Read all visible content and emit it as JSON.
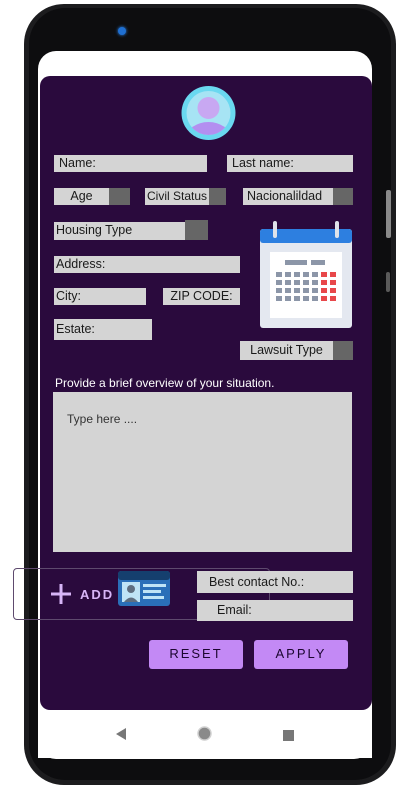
{
  "form": {
    "name_label": "Name:",
    "last_name_label": "Last name:",
    "age_label": "Age",
    "civil_status_label": "Civil Status",
    "nationality_label": "Nacionalildad",
    "housing_type_label": "Housing Type",
    "address_label": "Address:",
    "city_label": "City:",
    "zip_code_label": "ZIP CODE:",
    "estate_label": "Estate:",
    "lawsuit_type_label": "Lawsuit Type",
    "overview_prompt": "Provide a brief overview of your situation.",
    "overview_placeholder": "Type here ....",
    "add_label": "ADD",
    "best_contact_label": "Best contact No.:",
    "email_label": "Email:"
  },
  "buttons": {
    "reset": "RESET",
    "apply": "APPLY"
  },
  "icons": {
    "avatar": "user-avatar-icon",
    "calendar": "calendar-icon",
    "add": "plus-icon",
    "id_card": "id-card-icon",
    "nav_back": "back-triangle-icon",
    "nav_home": "home-circle-icon",
    "nav_recents": "recents-square-icon"
  },
  "colors": {
    "app_background": "#2a0a3d",
    "field_background": "#d4d4d4",
    "button_accent": "#c389f5"
  }
}
